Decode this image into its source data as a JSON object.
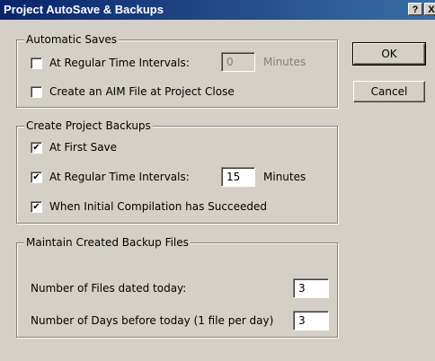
{
  "window": {
    "title": "Project AutoSave & Backups",
    "help_glyph": "?",
    "close_glyph": "X"
  },
  "automatic_saves": {
    "legend": "Automatic Saves",
    "regular_intervals": {
      "label": "At Regular Time Intervals:",
      "checked": false,
      "value": "0",
      "unit": "Minutes"
    },
    "aim_file": {
      "label": "Create an AIM File at Project Close",
      "checked": false
    }
  },
  "project_backups": {
    "legend": "Create Project Backups",
    "first_save": {
      "label": "At First Save",
      "checked": true
    },
    "regular_intervals": {
      "label": "At Regular Time Intervals:",
      "checked": true,
      "value": "15",
      "unit": "Minutes"
    },
    "compilation": {
      "label": "When Initial Compilation has Succeeded",
      "checked": true
    }
  },
  "backup_files": {
    "legend": "Maintain Created Backup Files",
    "files_today": {
      "label": "Number of Files dated today:",
      "value": "3"
    },
    "days_before": {
      "label": "Number of Days before today (1 file per day)",
      "value": "3"
    }
  },
  "buttons": {
    "ok": "OK",
    "cancel": "Cancel"
  }
}
